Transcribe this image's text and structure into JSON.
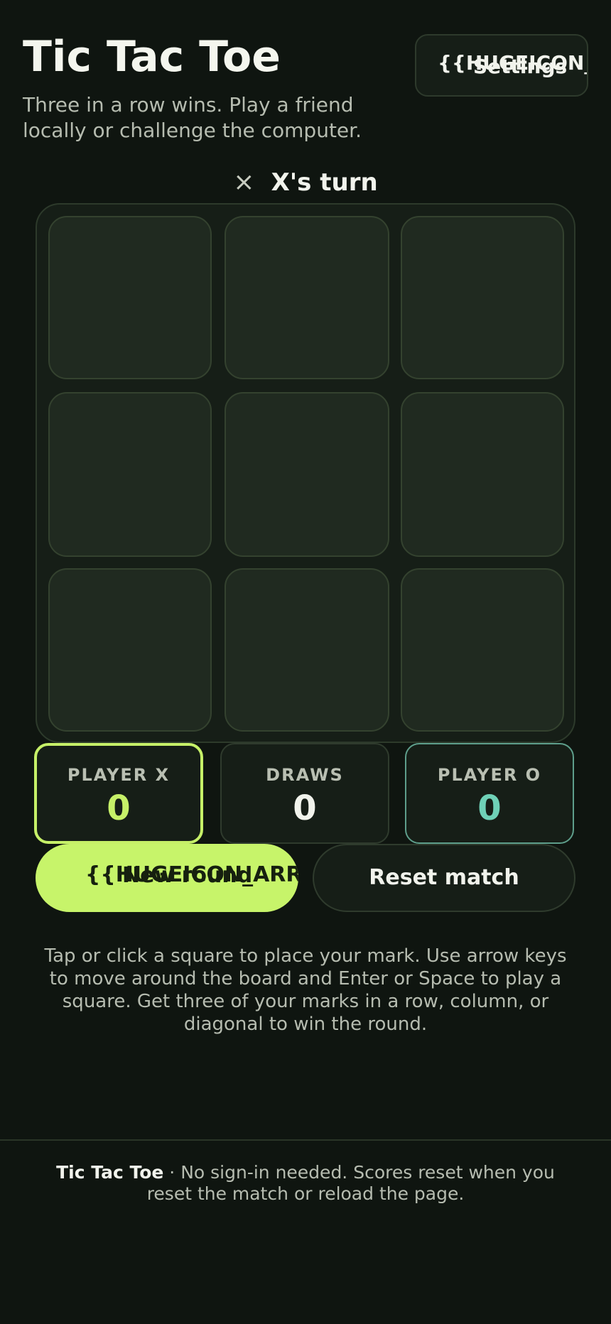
{
  "header": {
    "title": "Tic Tac Toe",
    "subtitle": "Three in a row wins. Play a friend locally or challenge the computer."
  },
  "settings": {
    "icon_placeholder": "{{HUGEICON_M",
    "label": "Settings",
    "icon": "settings-icon"
  },
  "turn": {
    "icon_glyph": "×",
    "text": "X's turn"
  },
  "board": {
    "cells": [
      "",
      "",
      "",
      "",
      "",
      "",
      "",
      "",
      ""
    ]
  },
  "scores": {
    "x": {
      "label": "PLAYER X",
      "value": "0",
      "color": "#c6f068"
    },
    "draws": {
      "label": "DRAWS",
      "value": "0",
      "color": "#f1f3ec"
    },
    "o": {
      "label": "PLAYER O",
      "value": "0",
      "color": "#6fd1b7"
    }
  },
  "actions": {
    "new_round_icon_placeholder": "{{HUGEICON_ARR",
    "new_round_label": "New round",
    "reset_label": "Reset match"
  },
  "instructions": "Tap or click a square to place your mark. Use arrow keys to move around the board and Enter or Space to play a square. Get three of your marks in a row, column, or diagonal to win the round.",
  "footer": {
    "brand": "Tic Tac Toe",
    "text": " · No sign-in needed. Scores reset when you reset the match or reload the page."
  },
  "colors": {
    "background": "#0f1510",
    "accent": "#c7f46a",
    "o_accent": "#6fd1b7"
  }
}
